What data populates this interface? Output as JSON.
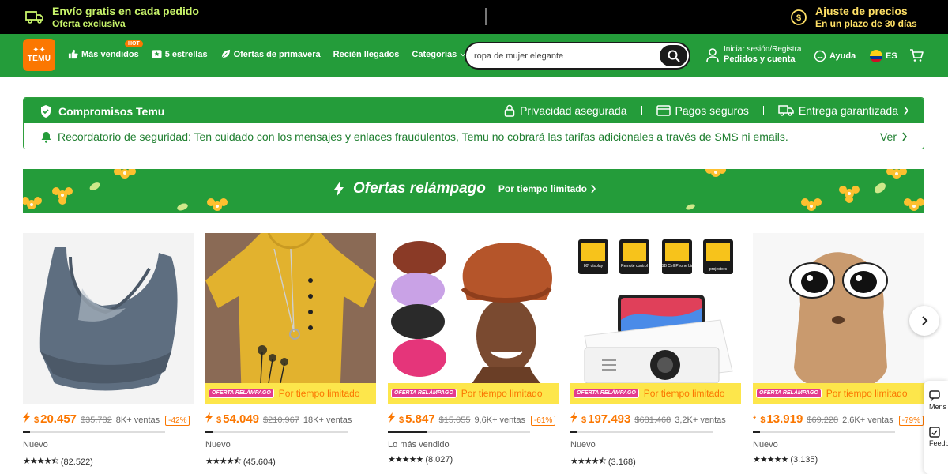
{
  "topbar": {
    "shipping_line1": "Envío gratis en cada pedido",
    "shipping_line2": "Oferta exclusiva",
    "price_line1": "Ajuste de precios",
    "price_line2": "En un plazo de 30 días"
  },
  "header": {
    "logo_text": "TEMU",
    "nav": [
      {
        "label": "Más vendidos",
        "icon": "thumbs-up-icon",
        "hot": "HOT"
      },
      {
        "label": "5 estrellas",
        "icon": "star-box-icon"
      },
      {
        "label": "Ofertas de primavera",
        "icon": "leaf-icon"
      },
      {
        "label": "Recién llegados"
      },
      {
        "label": "Categorías",
        "icon": "chevron-down-icon"
      }
    ],
    "search": {
      "value": "ropa de mujer elegante"
    },
    "account": {
      "line1": "Iniciar sesión/Registra",
      "line2": "Pedidos y cuenta"
    },
    "help_label": "Ayuda",
    "language": "ES"
  },
  "commitments": {
    "title": "Compromisos Temu",
    "items": [
      "Privacidad asegurada",
      "Pagos seguros",
      "Entrega garantizada"
    ],
    "notice": "Recordatorio de seguridad: Ten cuidado con los mensajes y enlaces fraudulentos, Temu no cobrará las tarifas adicionales a través de SMS ni emails.",
    "notice_link": "Ver"
  },
  "flash": {
    "title": "Ofertas relámpago",
    "subtitle": "Por tiempo limitado"
  },
  "products": [
    {
      "price_currency": "$",
      "price": "20.457",
      "old_price": "$35.782",
      "sales": "8K+ ventas",
      "discount": "-42%",
      "badge": "",
      "tag": "Nuevo",
      "rating_count": "(82.522)",
      "progress": 0.05
    },
    {
      "price_currency": "$",
      "price": "54.049",
      "old_price": "$210.967",
      "sales": "18K+ ventas",
      "discount": "",
      "badge": "Por tiempo limitado",
      "badge_img": "OFERTA RELÁMPAGO",
      "tag": "Nuevo",
      "rating_count": "(45.604)",
      "progress": 0.05
    },
    {
      "price_currency": "$",
      "price": "5.847",
      "old_price": "$15.055",
      "sales": "9,6K+ ventas",
      "discount": "-61%",
      "badge": "Por tiempo limitado",
      "badge_img": "OFERTA RELÁMPAGO",
      "tag": "Lo más vendido",
      "rating_count": "(8.027)",
      "progress": 0.27
    },
    {
      "price_currency": "$",
      "price": "197.493",
      "old_price": "$681.468",
      "sales": "3,2K+ ventas",
      "discount": "",
      "badge": "Por tiempo limitado",
      "badge_img": "OFERTA RELÁMPAGO",
      "tag": "Nuevo",
      "rating_count": "(3.168)",
      "progress": 0.05
    },
    {
      "price_currency": "$",
      "price": "13.919",
      "old_price": "$69.228",
      "sales": "2,6K+ ventas",
      "discount": "-79%",
      "badge": "Por tiempo limitado",
      "badge_img": "OFERTA RELÁMPAGO",
      "tag": "Nuevo",
      "rating_count": "(3.135)",
      "progress": 0.05
    }
  ],
  "projector_labels": [
    "80\" display",
    "Remote control",
    "USB Cell Phone Link",
    "projectors"
  ],
  "side_float": {
    "messages": "Mens",
    "feedback": "Feedb"
  },
  "colors": {
    "brand_orange": "#fb7701",
    "brand_green": "#249c3a",
    "topbar": "#000000",
    "badge_yellow": "#fde64b"
  }
}
